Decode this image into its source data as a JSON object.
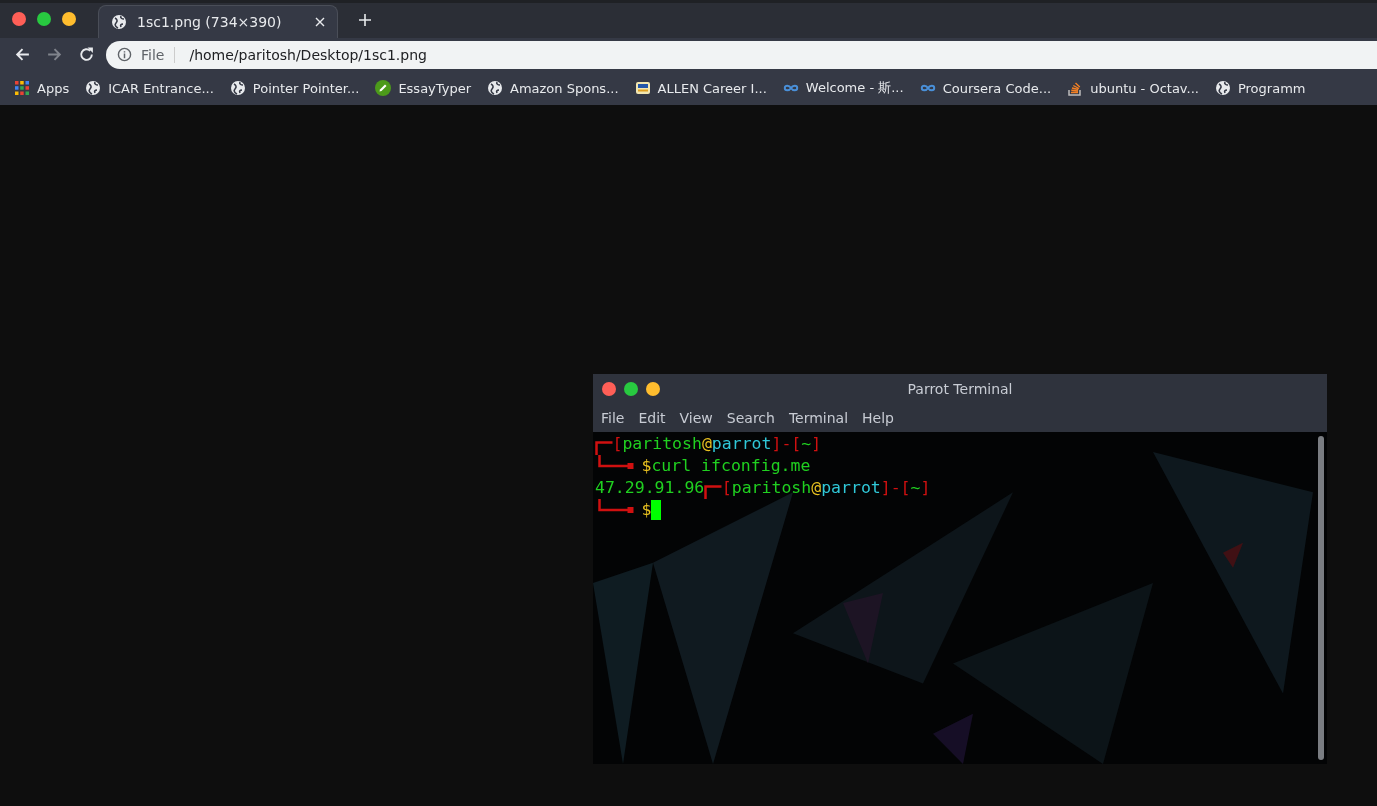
{
  "browser": {
    "tab": {
      "title": "1sc1.png (734×390)",
      "selected": true
    },
    "address": {
      "scheme": "File",
      "url": "/home/paritosh/Desktop/1sc1.png"
    },
    "bookmarks": [
      {
        "kind": "apps",
        "label": "Apps"
      },
      {
        "kind": "globe",
        "label": "ICAR Entrance..."
      },
      {
        "kind": "globe",
        "label": "Pointer Pointer..."
      },
      {
        "kind": "pencil",
        "label": "EssayTyper"
      },
      {
        "kind": "globe",
        "label": "Amazon Spons..."
      },
      {
        "kind": "badge",
        "label": "ALLEN Career I..."
      },
      {
        "kind": "link",
        "label": "Welcome - 斯..."
      },
      {
        "kind": "link",
        "label": "Coursera Code..."
      },
      {
        "kind": "stack",
        "label": "ubuntu - Octav..."
      },
      {
        "kind": "globe",
        "label": "Programm"
      }
    ]
  },
  "terminal": {
    "title": "Parrot Terminal",
    "menu": [
      "File",
      "Edit",
      "View",
      "Search",
      "Terminal",
      "Help"
    ],
    "lines": [
      {
        "parts": [
          {
            "kind": "corner_top"
          },
          {
            "kind": "text",
            "text": "[",
            "color": "#d01010"
          },
          {
            "kind": "text",
            "text": "paritosh",
            "color": "#20d020"
          },
          {
            "kind": "text",
            "text": "@",
            "color": "#e8c020"
          },
          {
            "kind": "text",
            "text": "parrot",
            "color": "#30c8d8"
          },
          {
            "kind": "text",
            "text": "]-[",
            "color": "#d01010"
          },
          {
            "kind": "text",
            "text": "~",
            "color": "#20d020"
          },
          {
            "kind": "text",
            "text": "]",
            "color": "#d01010"
          }
        ]
      },
      {
        "parts": [
          {
            "kind": "corner_bottom"
          },
          {
            "kind": "text",
            "text": "$",
            "color": "#e8c020"
          },
          {
            "kind": "text",
            "text": "curl ifconfig.me",
            "color": "#20d020"
          }
        ]
      },
      {
        "parts": [
          {
            "kind": "text",
            "text": "47.29.91.96",
            "color": "#20d020"
          },
          {
            "kind": "corner_top"
          },
          {
            "kind": "text",
            "text": "[",
            "color": "#d01010"
          },
          {
            "kind": "text",
            "text": "paritosh",
            "color": "#20d020"
          },
          {
            "kind": "text",
            "text": "@",
            "color": "#e8c020"
          },
          {
            "kind": "text",
            "text": "parrot",
            "color": "#30c8d8"
          },
          {
            "kind": "text",
            "text": "]-[",
            "color": "#d01010"
          },
          {
            "kind": "text",
            "text": "~",
            "color": "#20d020"
          },
          {
            "kind": "text",
            "text": "]",
            "color": "#d01010"
          }
        ]
      },
      {
        "parts": [
          {
            "kind": "corner_bottom"
          },
          {
            "kind": "text",
            "text": "$",
            "color": "#e8c020"
          },
          {
            "kind": "cursor"
          }
        ]
      }
    ]
  }
}
